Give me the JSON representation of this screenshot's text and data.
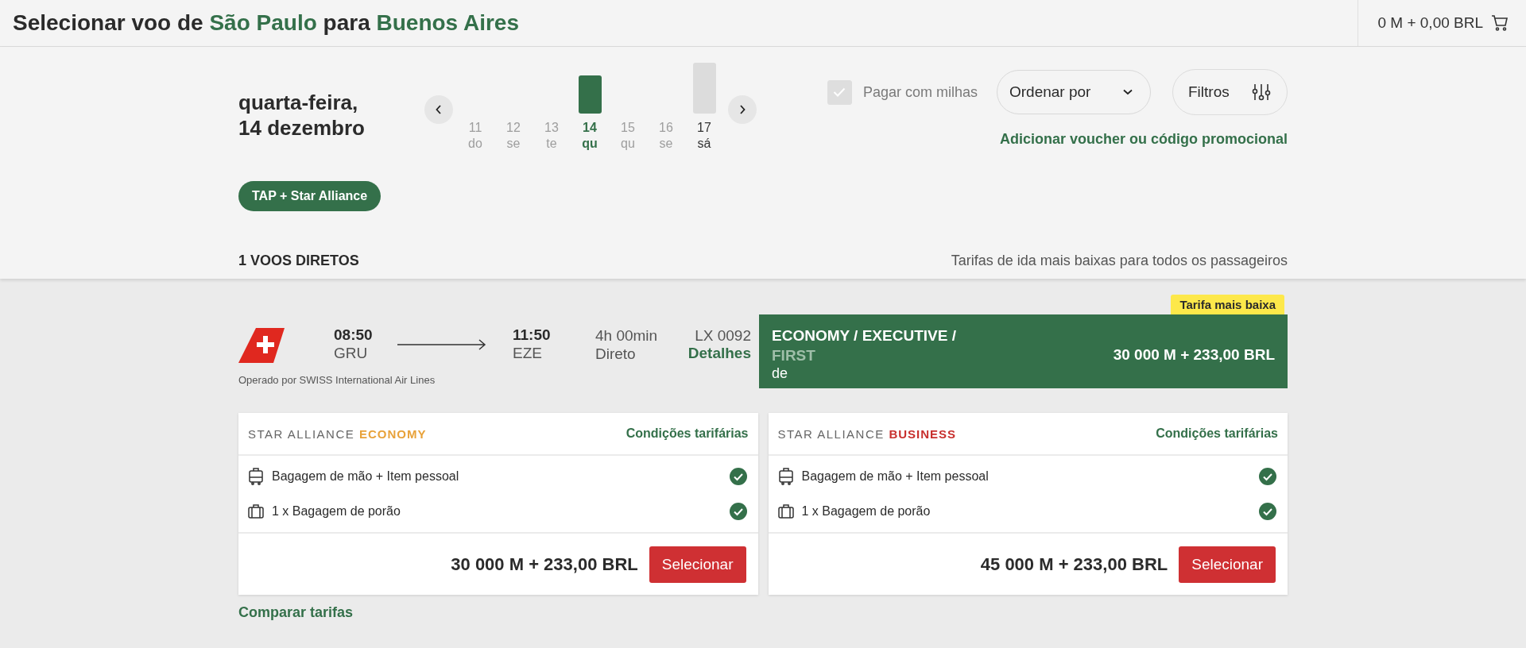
{
  "header": {
    "title_parts": [
      {
        "text": "Selecionar voo de",
        "highlight": false
      },
      {
        "text": "São Paulo",
        "highlight": true
      },
      {
        "text": "para",
        "highlight": false
      },
      {
        "text": "Buenos Aires",
        "highlight": true
      }
    ],
    "cart_total": "0 M + 0,00 BRL"
  },
  "date_heading": [
    "quarta-feira,",
    "14 dezembro"
  ],
  "dates": [
    {
      "day": "11",
      "weekday": "do",
      "kind": "plain",
      "selected": false,
      "disabled": true
    },
    {
      "day": "12",
      "weekday": "se",
      "kind": "plain",
      "selected": false,
      "disabled": true
    },
    {
      "day": "13",
      "weekday": "te",
      "kind": "plain",
      "selected": false,
      "disabled": true
    },
    {
      "day": "14",
      "weekday": "qu",
      "kind": "short-bar",
      "selected": true,
      "disabled": false
    },
    {
      "day": "15",
      "weekday": "qu",
      "kind": "plain",
      "selected": false,
      "disabled": true
    },
    {
      "day": "16",
      "weekday": "se",
      "kind": "plain",
      "selected": false,
      "disabled": true
    },
    {
      "day": "17",
      "weekday": "sá",
      "kind": "tall-bar",
      "selected": false,
      "disabled": false
    }
  ],
  "pay_with_miles": {
    "label": "Pagar com milhas",
    "checked": true,
    "disabled": true
  },
  "sort": {
    "label": "Ordenar por"
  },
  "filters": {
    "label": "Filtros"
  },
  "voucher_link": "Adicionar voucher ou código promocional",
  "alliance_filter": "TAP + Star Alliance",
  "results": {
    "count": "1 VOOS DIRETOS",
    "note": "Tarifas de ida mais baixas para todos os passageiros"
  },
  "flight": {
    "departure_time": "08:50",
    "departure_airport": "GRU",
    "arrival_time": "11:50",
    "arrival_airport": "EZE",
    "duration": "4h 00min",
    "stops": "Direto",
    "flight_number": "LX 0092",
    "details_link": "Detalhes",
    "operated_by": "Operado por SWISS International Air Lines",
    "badge": "Tarifa mais baixa",
    "cabins": [
      {
        "label": "ECONOMY /",
        "available": true
      },
      {
        "label": "EXECUTIVE /",
        "available": true
      },
      {
        "label": "FIRST",
        "available": false
      }
    ],
    "from_label": "de",
    "price": "30 000 M + 233,00 BRL"
  },
  "fares": [
    {
      "brand": "STAR ALLIANCE",
      "cabin": "ECONOMY",
      "color": "#e8a23a",
      "conditions_link": "Condições tarifárias",
      "features": [
        {
          "kind": "hand-luggage",
          "label": "Bagagem de mão + Item pessoal",
          "included": true
        },
        {
          "kind": "checked-bag",
          "label": "1 x Bagagem de porão",
          "included": true
        }
      ],
      "price": "30 000 M + 233,00 BRL",
      "button": "Selecionar"
    },
    {
      "brand": "STAR ALLIANCE",
      "cabin": "BUSINESS",
      "color": "#c8302e",
      "conditions_link": "Condições tarifárias",
      "features": [
        {
          "kind": "hand-luggage",
          "label": "Bagagem de mão + Item pessoal",
          "included": true
        },
        {
          "kind": "checked-bag",
          "label": "1 x Bagagem de porão",
          "included": true
        }
      ],
      "price": "45 000 M + 233,00 BRL",
      "button": "Selecionar"
    }
  ],
  "compare_link": "Comparar tarifas"
}
